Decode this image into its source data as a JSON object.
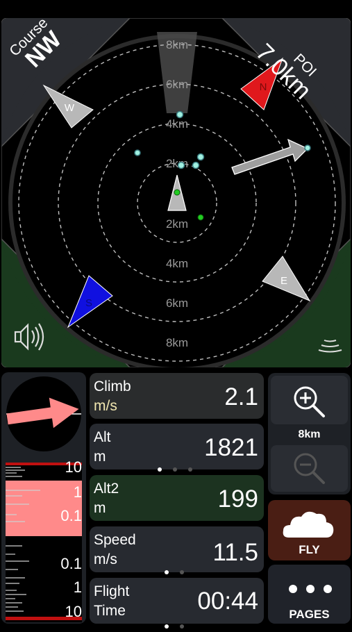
{
  "radar": {
    "course_label": "Course",
    "course_value": "NW",
    "poi_label": "POI",
    "poi_value": "7.0km",
    "ring_labels_top": [
      "8km",
      "6km",
      "4km",
      "2km"
    ],
    "ring_labels_bottom": [
      "2km",
      "4km",
      "6km",
      "8km"
    ],
    "compass": {
      "north": "N",
      "south": "S",
      "east": "E",
      "west": "W"
    },
    "sound_icon": "speaker-icon",
    "signal_icon": "signal-waves-icon",
    "colors": {
      "north": "#e0181c",
      "south": "#1010e0",
      "quadrant_top": "#2a2c31",
      "quadrant_bottom": "#1a3a1e"
    }
  },
  "vario": {
    "scale": [
      "10",
      "1",
      "0.1",
      "0.1",
      "1",
      "10"
    ],
    "arrow_color": "#ff8a8a"
  },
  "tiles": [
    {
      "label": "Climb",
      "unit": "m/s",
      "value": "2.1"
    },
    {
      "label": "Alt",
      "unit": "m",
      "value": "1821"
    },
    {
      "label": "Alt2",
      "unit": "m",
      "value": "199"
    },
    {
      "label": "Speed",
      "unit": "m/s",
      "value": "11.5"
    },
    {
      "label": "Flight",
      "unit": "Time",
      "value": "00:44"
    }
  ],
  "buttons": {
    "zoom_in_icon": "zoom-in-icon",
    "zoom_level": "8km",
    "zoom_out_icon": "zoom-out-icon",
    "fly_label": "FLY",
    "fly_icon": "cloud-icon",
    "pages_label": "PAGES",
    "pages_icon": "more-dots-icon"
  }
}
